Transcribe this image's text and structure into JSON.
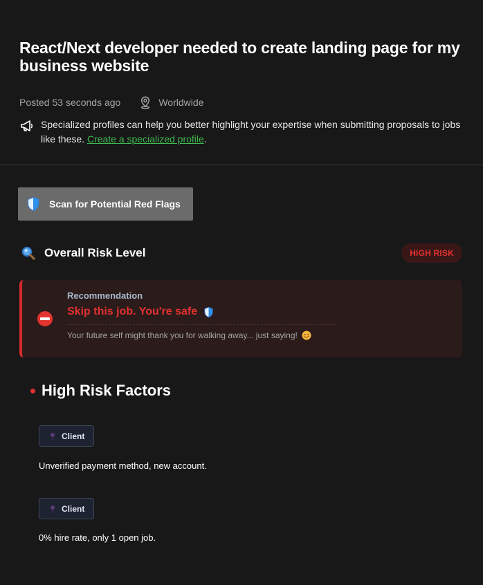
{
  "job": {
    "title": "React/Next developer needed to create landing page for my business website",
    "posted": "Posted 53 seconds ago",
    "location": "Worldwide",
    "location_icon": "map-pin-icon",
    "promo_text": "Specialized profiles can help you better highlight your expertise when submitting proposals to jobs like these.",
    "promo_link": "Create a specialized profile",
    "promo_end": ".",
    "promo_icon": "megaphone-icon"
  },
  "scan": {
    "button_label": "Scan for Potential Red Flags",
    "icon": "shield-icon"
  },
  "risk": {
    "title": "Overall Risk Level",
    "icon": "magnifier-icon",
    "badge": "HIGH RISK",
    "badge_color": "#e0322f"
  },
  "recommendation": {
    "label": "Recommendation",
    "headline": "Skip this job. You're safe",
    "subtext": "Your future self might thank you for walking away... just saying!",
    "icon": "stop-icon",
    "accent_color": "#d72b2b"
  },
  "factors": {
    "heading": "High Risk Factors",
    "items": [
      {
        "tag": "Client",
        "description": "Unverified payment method, new account."
      },
      {
        "tag": "Client",
        "description": "0% hire rate, only 1 open job."
      }
    ]
  },
  "colors": {
    "background": "#181818",
    "link": "#3fb950",
    "danger": "#e0322f"
  }
}
